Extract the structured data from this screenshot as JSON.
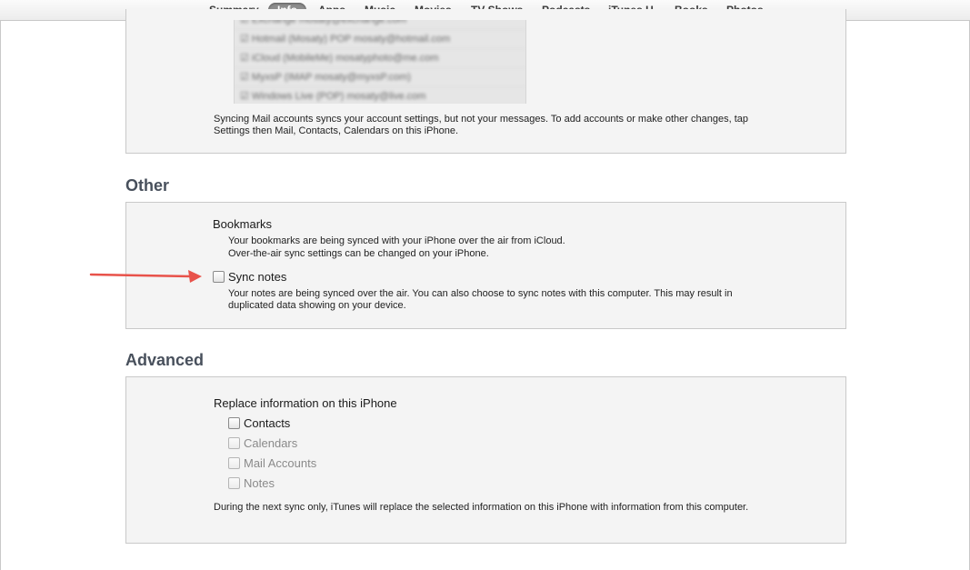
{
  "tabs": {
    "summary": "Summary",
    "info": "Info",
    "apps": "Apps",
    "music": "Music",
    "movies": "Movies",
    "tv_shows": "TV Shows",
    "podcasts": "Podcasts",
    "itunes_u": "iTunes U",
    "books": "Books",
    "photos": "Photos"
  },
  "mail": {
    "accounts": [
      "☑ Exchange mosaty@exchange.com",
      "☑ Hotmail (Mosaty) POP mosaty@hotmail.com",
      "☑ iCloud (MobileMe) mosatyphoto@me.com",
      "☑ MyxsP (IMAP mosaty@myxsP.com)",
      "☑ Windows Live (POP) mosaty@live.com"
    ],
    "note": "Syncing Mail accounts syncs your account settings, but not your messages. To add accounts or make other changes, tap Settings then Mail, Contacts, Calendars on this iPhone."
  },
  "other": {
    "title": "Other",
    "bookmarks_heading": "Bookmarks",
    "bookmarks_line1": "Your bookmarks are being synced with your iPhone over the air from iCloud.",
    "bookmarks_line2": "Over-the-air sync settings can be changed on your iPhone.",
    "sync_notes_label": "Sync notes",
    "sync_notes_desc": "Your notes are being synced over the air. You can also choose to sync notes with this computer. This may result in duplicated data showing on your device.",
    "arrow_color": "#e8524a"
  },
  "advanced": {
    "title": "Advanced",
    "heading": "Replace information on this iPhone",
    "options": {
      "contacts": "Contacts",
      "calendars": "Calendars",
      "mail_accounts": "Mail Accounts",
      "notes": "Notes"
    },
    "note": "During the next sync only, iTunes will replace the selected information on this iPhone with information from this computer."
  }
}
